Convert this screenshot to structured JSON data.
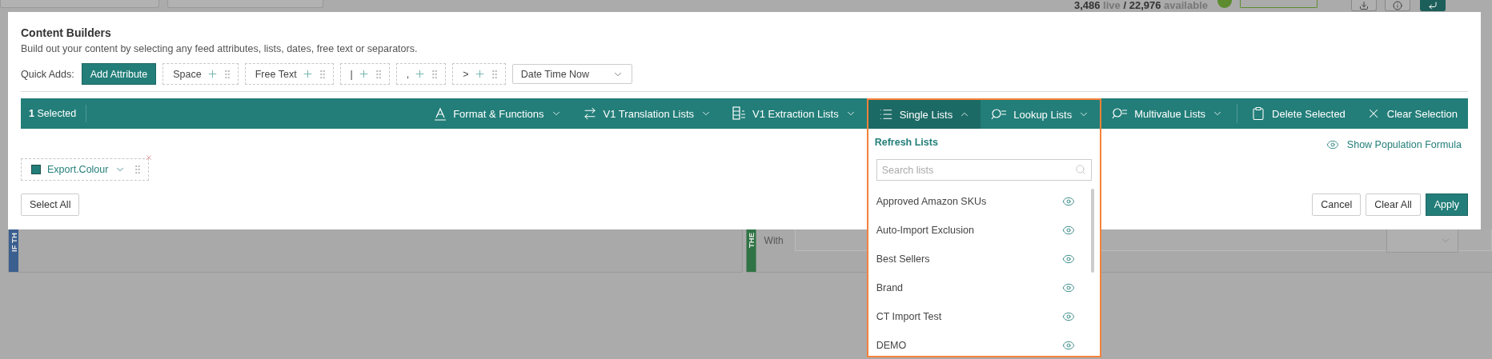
{
  "backdrop": {
    "counts": {
      "live": "3,486",
      "live_label": "live",
      "separator": "/",
      "available": "22,976",
      "available_label": "available"
    },
    "condition_panel": {
      "label": "IF TH"
    },
    "action_panel": {
      "label": "THE",
      "field_label": "With"
    }
  },
  "content_builders": {
    "title": "Content Builders",
    "description": "Build out your content by selecting any feed attributes, lists, dates, free text or separators.",
    "quick_adds": {
      "label": "Quick Adds:",
      "add_attribute": "Add Attribute",
      "chips": [
        {
          "label": "Space"
        },
        {
          "label": "Free Text"
        },
        {
          "label": "|"
        },
        {
          "label": ","
        },
        {
          "label": ">"
        }
      ],
      "date_select": {
        "value": "Date Time Now"
      }
    },
    "toolbar": {
      "selected_count": "1",
      "selected_label": "Selected",
      "menus": [
        {
          "label": "Format & Functions",
          "kind": "format",
          "expanded": false
        },
        {
          "label": "V1 Translation Lists",
          "kind": "translation",
          "expanded": false
        },
        {
          "label": "V1 Extraction Lists",
          "kind": "extraction",
          "expanded": false
        },
        {
          "label": "Single Lists",
          "kind": "list",
          "expanded": true
        },
        {
          "label": "Lookup Lists",
          "kind": "lookup",
          "expanded": false
        },
        {
          "label": "Multivalue Lists",
          "kind": "lookup",
          "expanded": false
        }
      ],
      "actions": [
        {
          "label": "Delete Selected",
          "kind": "delete"
        },
        {
          "label": "Clear Selection",
          "kind": "clear"
        }
      ]
    },
    "dropdown": {
      "refresh": "Refresh Lists",
      "search": {
        "placeholder": "Search lists"
      },
      "items": [
        {
          "label": "Approved Amazon SKUs"
        },
        {
          "label": "Auto-Import Exclusion"
        },
        {
          "label": "Best Sellers"
        },
        {
          "label": "Brand"
        },
        {
          "label": "CT Import Test"
        },
        {
          "label": "DEMO"
        }
      ]
    },
    "show_formula": "Show Population Formula",
    "attributes": [
      {
        "label": "Export.Colour",
        "selected": true
      }
    ],
    "buttons": {
      "select_all": "Select All",
      "cancel": "Cancel",
      "clear_all": "Clear All",
      "apply": "Apply"
    }
  }
}
